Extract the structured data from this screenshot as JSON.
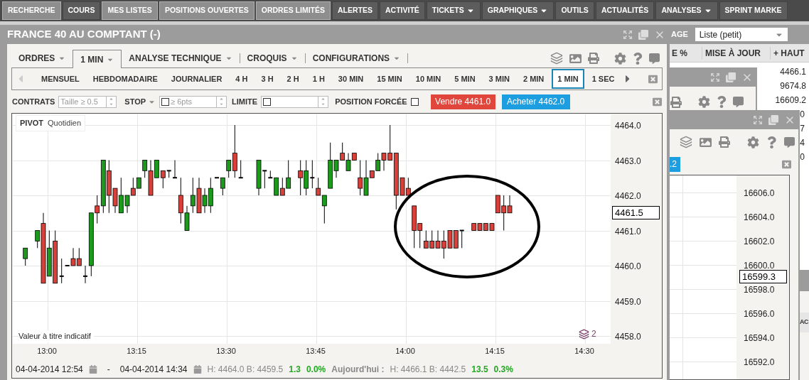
{
  "nav": [
    {
      "label": "RECHERCHE",
      "selected": true,
      "dropdown": false
    },
    {
      "label": "COURS",
      "selected": false,
      "dropdown": false
    },
    {
      "label": "MES LISTES",
      "selected": true,
      "dropdown": false
    },
    {
      "label": "POSITIONS OUVERTES",
      "selected": true,
      "dropdown": false
    },
    {
      "label": "ORDRES LIMITÉS",
      "selected": true,
      "dropdown": false
    },
    {
      "label": "ALERTES",
      "selected": false,
      "dropdown": false
    },
    {
      "label": "ACTIVITÉ",
      "selected": false,
      "dropdown": false
    },
    {
      "label": "TICKETS",
      "selected": false,
      "dropdown": true
    },
    {
      "label": "GRAPHIQUES",
      "selected": false,
      "dropdown": true
    },
    {
      "label": "OUTILS",
      "selected": false,
      "dropdown": false
    },
    {
      "label": "ACTUALITÉS",
      "selected": false,
      "dropdown": false
    },
    {
      "label": "ANALYSES",
      "selected": false,
      "dropdown": true
    },
    {
      "label": "SPRINT MARKE",
      "selected": false,
      "dropdown": false
    }
  ],
  "window": {
    "title": "FRANCE 40 AU COMPTANT (-)"
  },
  "menu": [
    {
      "label": "ORDRES",
      "selected": false
    },
    {
      "label": "1 MIN",
      "selected": true
    },
    {
      "label": "ANALYSE TECHNIQUE",
      "selected": false
    },
    {
      "label": "CROQUIS",
      "selected": false
    },
    {
      "label": "CONFIGURATIONS",
      "selected": false
    }
  ],
  "timeframes": [
    {
      "label": "MENSUEL",
      "selected": false
    },
    {
      "label": "HEBDOMADAIRE",
      "selected": false
    },
    {
      "label": "JOURNALIER",
      "selected": false
    },
    {
      "label": "4 H",
      "selected": false
    },
    {
      "label": "3 H",
      "selected": false
    },
    {
      "label": "2 H",
      "selected": false
    },
    {
      "label": "1 H",
      "selected": false
    },
    {
      "label": "30 MIN",
      "selected": false
    },
    {
      "label": "15 MIN",
      "selected": false
    },
    {
      "label": "10 MIN",
      "selected": false
    },
    {
      "label": "5 MIN",
      "selected": false
    },
    {
      "label": "3 MIN",
      "selected": false
    },
    {
      "label": "2 MIN",
      "selected": false
    },
    {
      "label": "1 MIN",
      "selected": true
    },
    {
      "label": "1 SEC",
      "selected": false
    }
  ],
  "order_bar": {
    "contracts_label": "CONTRATS",
    "contracts_placeholder": "Taille ≥ 0.5",
    "stop_label": "STOP",
    "stop_placeholder": "≥ 6pts",
    "stop_checked": false,
    "limit_label": "LIMITE",
    "limit_checked": false,
    "forced_label": "POSITION FORCÉE",
    "forced_checked": false,
    "sell": "Vendre 4461.0",
    "buy": "Acheter 4462.0"
  },
  "chart": {
    "legend_title": "PIVOT",
    "legend_sub": "Quotidien",
    "note": "Valeur à titre indicatif",
    "yticks": [
      "4464.0",
      "4463.0",
      "4462.0",
      "4461.0",
      "4460.0",
      "4459.0",
      "4458.0"
    ],
    "xticks": [
      "13:00",
      "13:15",
      "13:30",
      "13:45",
      "14:00",
      "14:15",
      "14:30"
    ],
    "last_price": "4461.5",
    "layers_count": "2"
  },
  "footer": {
    "from": "04-04-2014 12:54",
    "dash": "-",
    "to": "04-04-2014 14:34",
    "range": "H: 4464.0  B: 4459.5",
    "change": "1.3",
    "change_pct": "0.0%",
    "today_label": "Aujourd'hui :",
    "today_range": "H: 4466.1  B: 4442.5",
    "today_change": "13.5",
    "today_pct": "0.3%"
  },
  "side_window": {
    "view_label": "AGE",
    "view_value": "Liste (petit)",
    "columns": [
      "E %",
      "MISE À JOUR",
      "+ HAUT"
    ],
    "high_values": [
      "4466.1",
      "9674.8",
      "16609.2"
    ],
    "clipped_values": [
      "0",
      "7",
      "4",
      "0"
    ]
  },
  "second_chart": {
    "button": ".2",
    "yticks": [
      "16606.0",
      "16604.0",
      "16602.0",
      "16600.0",
      "16598.0",
      "16596.0",
      "16594.0",
      "16592.0"
    ],
    "last_price": "16599.3"
  },
  "third_window": {
    "label": "AC"
  }
}
